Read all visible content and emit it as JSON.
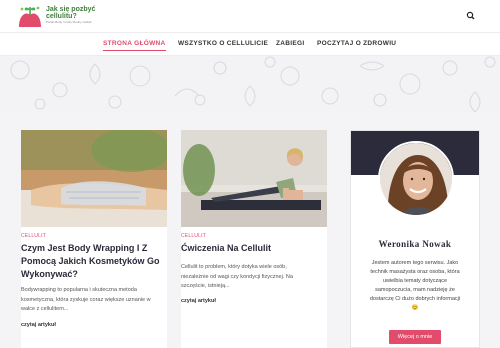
{
  "header": {
    "logo_line1": "Jak się pozbyć",
    "logo_line2": "cellulitu?",
    "logo_tagline": "Portal Mody i urody Modny Cellulit"
  },
  "nav": {
    "items": [
      {
        "label": "STRONA GŁÓWNA",
        "active": true
      },
      {
        "label": "WSZYSTKO O CELLULICIE",
        "active": false
      },
      {
        "label": "ZABIEGI",
        "active": false
      },
      {
        "label": "POCZYTAJ O ZDROWIU",
        "active": false
      }
    ]
  },
  "posts": [
    {
      "category": "CELLULIT",
      "title_lines": [
        "Czym Jest Body Wrapping I Z",
        "Pomocą Jakich Kosmetyków Go",
        "Wykonywać?"
      ],
      "excerpt_lines": [
        "Bodywrapping to popularna i skuteczna metoda",
        "kosmetyczna, która zyskuje coraz większe uznanie w",
        "walce z cellulitem..."
      ],
      "read_more": "czytaj artykuł"
    },
    {
      "category": "CELLULIT",
      "title_lines": [
        "Ćwiczenia Na Cellulit"
      ],
      "excerpt_lines": [
        "Cellulit to problem, który dotyka wiele osób,",
        "niezależnie od wagi czy kondycji fizycznej. Na",
        "szczęście, istnieją..."
      ],
      "read_more": "czytaj artykuł"
    }
  ],
  "sidebar": {
    "name": "Weronika Nowak",
    "bio_lines": [
      "Jestem autorem tego serwisu. Jako",
      "technik masażysta oraz osoba, która",
      "uwielbia tematy dotyczące",
      "samopoczucia, mam nadzieję że",
      "dostarczę Ci dużo dobrych informacji",
      "😊"
    ],
    "button_label": "Więcej o mnie"
  },
  "colors": {
    "accent": "#e24b6b",
    "sidebar_header": "#2b2b3c",
    "title": "#2a2a3a"
  }
}
